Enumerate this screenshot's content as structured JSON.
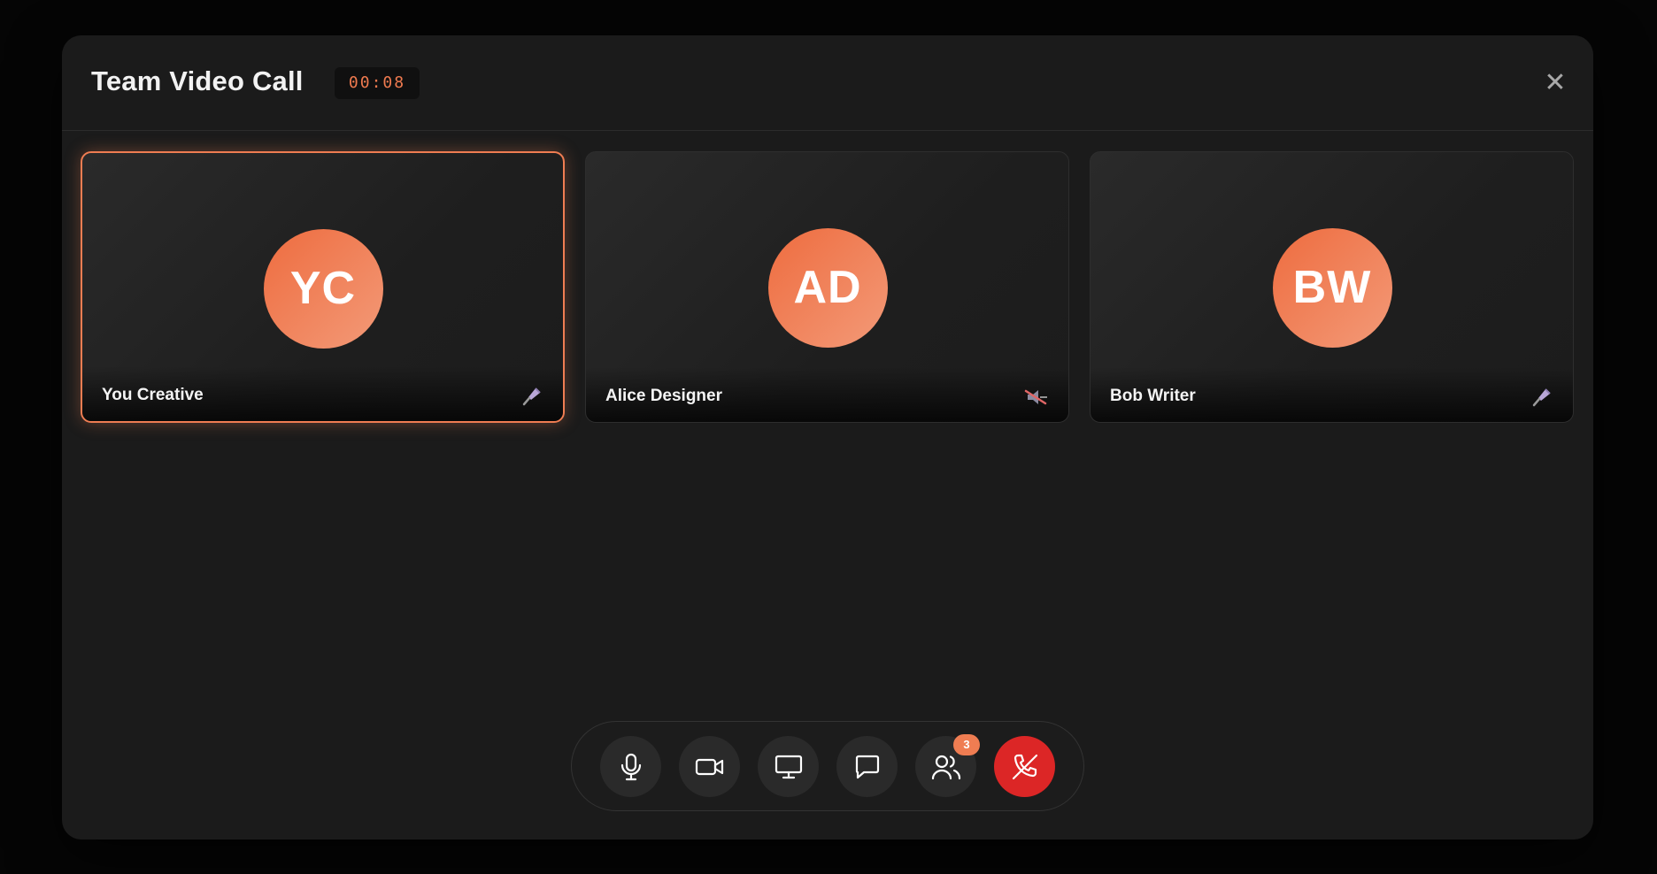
{
  "call": {
    "title": "Team Video Call",
    "timer": "00:08",
    "close_label": "✕"
  },
  "participants": [
    {
      "initials": "YC",
      "name": "You Creative",
      "mic": "on",
      "active": true
    },
    {
      "initials": "AD",
      "name": "Alice Designer",
      "mic": "muted",
      "active": false
    },
    {
      "initials": "BW",
      "name": "Bob Writer",
      "mic": "on",
      "active": false
    }
  ],
  "controls": {
    "buttons": [
      "microphone-icon",
      "video-camera-icon",
      "screen-share-icon",
      "chat-icon",
      "participants-icon",
      "end-call-icon"
    ],
    "participants_count": "3"
  },
  "colors": {
    "accent": "#ef7d52",
    "end_call": "#dc2626",
    "modal_bg": "#1b1b1b"
  }
}
